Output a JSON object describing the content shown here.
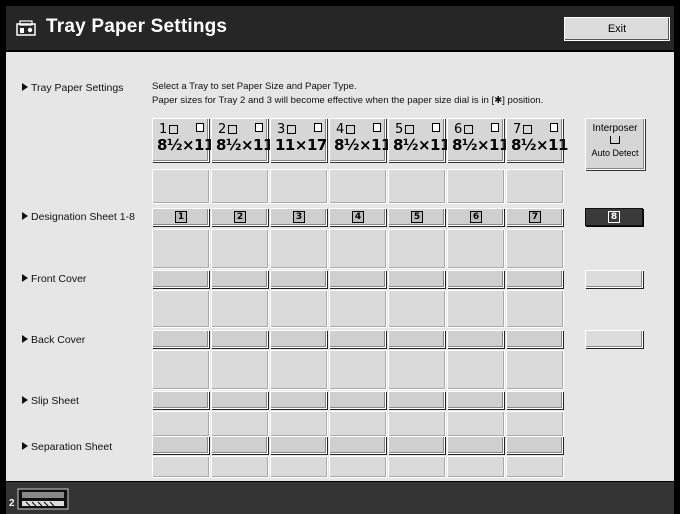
{
  "window": {
    "title": "Tray Paper Settings",
    "exit_label": "Exit"
  },
  "instructions": {
    "line1": "Select a Tray to set Paper Size and Paper Type.",
    "line2": "Paper sizes for Tray 2 and 3 will become effective when the paper size dial is in [✱] position."
  },
  "rows": {
    "tray_paper_settings": "Tray Paper Settings",
    "designation_sheet": "Designation Sheet 1-8",
    "front_cover": "Front Cover",
    "back_cover": "Back Cover",
    "slip_sheet": "Slip Sheet",
    "separation_sheet": "Separation Sheet"
  },
  "trays": [
    {
      "num": "1",
      "size": "8½×11"
    },
    {
      "num": "2",
      "size": "8½×11"
    },
    {
      "num": "3",
      "size": "11×17"
    },
    {
      "num": "4",
      "size": "8½×11"
    },
    {
      "num": "5",
      "size": "8½×11"
    },
    {
      "num": "6",
      "size": "8½×11"
    },
    {
      "num": "7",
      "size": "8½×11"
    }
  ],
  "interposer": {
    "label": "Interposer",
    "mode": "Auto Detect"
  },
  "designation_slots": [
    "1",
    "2",
    "3",
    "4",
    "5",
    "6",
    "7",
    "8"
  ],
  "selected_designation": "8",
  "status": {
    "counter": "2"
  },
  "colors": {
    "title_bar": "#262626",
    "panel": "#e6e6e6",
    "selected": "#3a3a3a"
  }
}
